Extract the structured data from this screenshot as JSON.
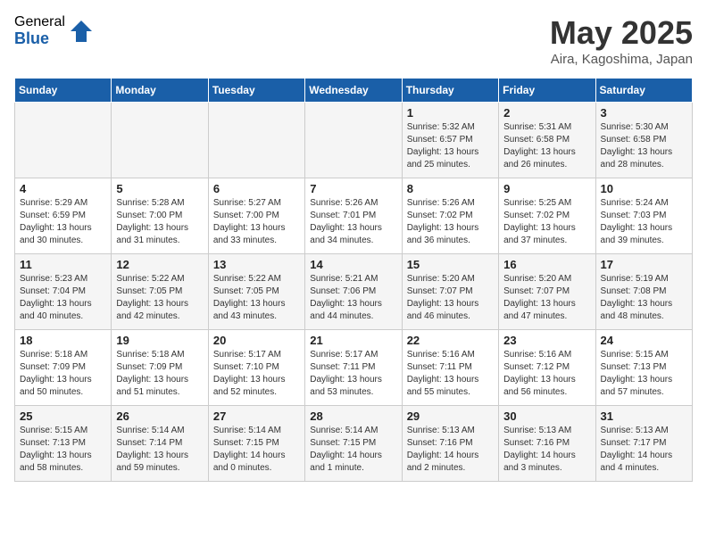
{
  "logo": {
    "general": "General",
    "blue": "Blue"
  },
  "header": {
    "month": "May 2025",
    "location": "Aira, Kagoshima, Japan"
  },
  "days_of_week": [
    "Sunday",
    "Monday",
    "Tuesday",
    "Wednesday",
    "Thursday",
    "Friday",
    "Saturday"
  ],
  "weeks": [
    [
      {
        "day": "",
        "info": ""
      },
      {
        "day": "",
        "info": ""
      },
      {
        "day": "",
        "info": ""
      },
      {
        "day": "",
        "info": ""
      },
      {
        "day": "1",
        "info": "Sunrise: 5:32 AM\nSunset: 6:57 PM\nDaylight: 13 hours\nand 25 minutes."
      },
      {
        "day": "2",
        "info": "Sunrise: 5:31 AM\nSunset: 6:58 PM\nDaylight: 13 hours\nand 26 minutes."
      },
      {
        "day": "3",
        "info": "Sunrise: 5:30 AM\nSunset: 6:58 PM\nDaylight: 13 hours\nand 28 minutes."
      }
    ],
    [
      {
        "day": "4",
        "info": "Sunrise: 5:29 AM\nSunset: 6:59 PM\nDaylight: 13 hours\nand 30 minutes."
      },
      {
        "day": "5",
        "info": "Sunrise: 5:28 AM\nSunset: 7:00 PM\nDaylight: 13 hours\nand 31 minutes."
      },
      {
        "day": "6",
        "info": "Sunrise: 5:27 AM\nSunset: 7:00 PM\nDaylight: 13 hours\nand 33 minutes."
      },
      {
        "day": "7",
        "info": "Sunrise: 5:26 AM\nSunset: 7:01 PM\nDaylight: 13 hours\nand 34 minutes."
      },
      {
        "day": "8",
        "info": "Sunrise: 5:26 AM\nSunset: 7:02 PM\nDaylight: 13 hours\nand 36 minutes."
      },
      {
        "day": "9",
        "info": "Sunrise: 5:25 AM\nSunset: 7:02 PM\nDaylight: 13 hours\nand 37 minutes."
      },
      {
        "day": "10",
        "info": "Sunrise: 5:24 AM\nSunset: 7:03 PM\nDaylight: 13 hours\nand 39 minutes."
      }
    ],
    [
      {
        "day": "11",
        "info": "Sunrise: 5:23 AM\nSunset: 7:04 PM\nDaylight: 13 hours\nand 40 minutes."
      },
      {
        "day": "12",
        "info": "Sunrise: 5:22 AM\nSunset: 7:05 PM\nDaylight: 13 hours\nand 42 minutes."
      },
      {
        "day": "13",
        "info": "Sunrise: 5:22 AM\nSunset: 7:05 PM\nDaylight: 13 hours\nand 43 minutes."
      },
      {
        "day": "14",
        "info": "Sunrise: 5:21 AM\nSunset: 7:06 PM\nDaylight: 13 hours\nand 44 minutes."
      },
      {
        "day": "15",
        "info": "Sunrise: 5:20 AM\nSunset: 7:07 PM\nDaylight: 13 hours\nand 46 minutes."
      },
      {
        "day": "16",
        "info": "Sunrise: 5:20 AM\nSunset: 7:07 PM\nDaylight: 13 hours\nand 47 minutes."
      },
      {
        "day": "17",
        "info": "Sunrise: 5:19 AM\nSunset: 7:08 PM\nDaylight: 13 hours\nand 48 minutes."
      }
    ],
    [
      {
        "day": "18",
        "info": "Sunrise: 5:18 AM\nSunset: 7:09 PM\nDaylight: 13 hours\nand 50 minutes."
      },
      {
        "day": "19",
        "info": "Sunrise: 5:18 AM\nSunset: 7:09 PM\nDaylight: 13 hours\nand 51 minutes."
      },
      {
        "day": "20",
        "info": "Sunrise: 5:17 AM\nSunset: 7:10 PM\nDaylight: 13 hours\nand 52 minutes."
      },
      {
        "day": "21",
        "info": "Sunrise: 5:17 AM\nSunset: 7:11 PM\nDaylight: 13 hours\nand 53 minutes."
      },
      {
        "day": "22",
        "info": "Sunrise: 5:16 AM\nSunset: 7:11 PM\nDaylight: 13 hours\nand 55 minutes."
      },
      {
        "day": "23",
        "info": "Sunrise: 5:16 AM\nSunset: 7:12 PM\nDaylight: 13 hours\nand 56 minutes."
      },
      {
        "day": "24",
        "info": "Sunrise: 5:15 AM\nSunset: 7:13 PM\nDaylight: 13 hours\nand 57 minutes."
      }
    ],
    [
      {
        "day": "25",
        "info": "Sunrise: 5:15 AM\nSunset: 7:13 PM\nDaylight: 13 hours\nand 58 minutes."
      },
      {
        "day": "26",
        "info": "Sunrise: 5:14 AM\nSunset: 7:14 PM\nDaylight: 13 hours\nand 59 minutes."
      },
      {
        "day": "27",
        "info": "Sunrise: 5:14 AM\nSunset: 7:15 PM\nDaylight: 14 hours\nand 0 minutes."
      },
      {
        "day": "28",
        "info": "Sunrise: 5:14 AM\nSunset: 7:15 PM\nDaylight: 14 hours\nand 1 minute."
      },
      {
        "day": "29",
        "info": "Sunrise: 5:13 AM\nSunset: 7:16 PM\nDaylight: 14 hours\nand 2 minutes."
      },
      {
        "day": "30",
        "info": "Sunrise: 5:13 AM\nSunset: 7:16 PM\nDaylight: 14 hours\nand 3 minutes."
      },
      {
        "day": "31",
        "info": "Sunrise: 5:13 AM\nSunset: 7:17 PM\nDaylight: 14 hours\nand 4 minutes."
      }
    ]
  ]
}
